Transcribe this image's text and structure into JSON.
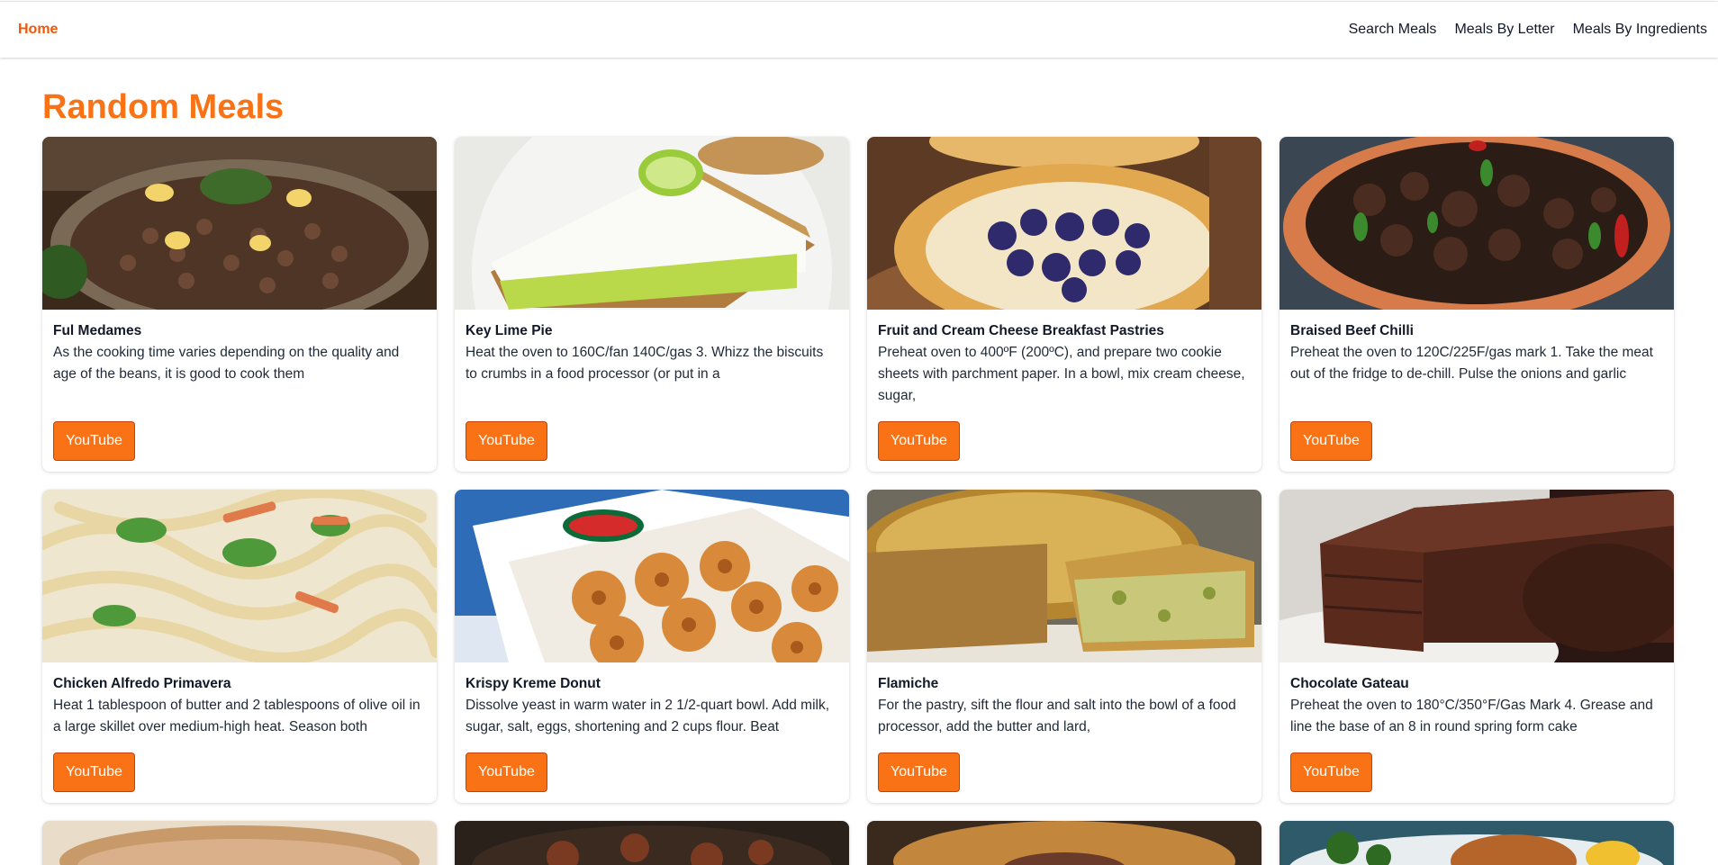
{
  "nav": {
    "home": "Home",
    "links": [
      "Search Meals",
      "Meals By Letter",
      "Meals By Ingredients"
    ]
  },
  "page": {
    "title": "Random Meals"
  },
  "colors": {
    "accent": "#f97316",
    "accent_dark": "#ea580c"
  },
  "meals": [
    {
      "title": "Ful Medames",
      "desc": "As the cooking time varies depending on the quality and age of the beans, it is good to cook them",
      "button": "YouTube",
      "image": "beans-dish-image"
    },
    {
      "title": "Key Lime Pie",
      "desc": "Heat the oven to 160C/fan 140C/gas 3. Whizz the biscuits to crumbs in a food processor (or put in a",
      "button": "YouTube",
      "image": "lime-pie-image"
    },
    {
      "title": "Fruit and Cream Cheese Breakfast Pastries",
      "desc": "Preheat oven to 400ºF (200ºC), and prepare two cookie sheets with parchment paper. In a bowl, mix cream cheese, sugar,",
      "button": "YouTube",
      "image": "blueberry-pastry-image"
    },
    {
      "title": "Braised Beef Chilli",
      "desc": "Preheat the oven to 120C/225F/gas mark 1. Take the meat out of the fridge to de-chill. Pulse the onions and garlic",
      "button": "YouTube",
      "image": "beef-chilli-image"
    },
    {
      "title": "Chicken Alfredo Primavera",
      "desc": "Heat 1 tablespoon of butter and 2 tablespoons of olive oil in a large skillet over medium-high heat. Season both",
      "button": "YouTube",
      "image": "pasta-image"
    },
    {
      "title": "Krispy Kreme Donut",
      "desc": "Dissolve yeast in warm water in 2 1/2-quart bowl. Add milk, sugar, salt, eggs, shortening and 2 cups flour. Beat",
      "button": "YouTube",
      "image": "donuts-image"
    },
    {
      "title": "Flamiche",
      "desc": "For the pastry, sift the flour and salt into the bowl of a food processor, add the butter and lard,",
      "button": "YouTube",
      "image": "quiche-image"
    },
    {
      "title": "Chocolate Gateau",
      "desc": "Preheat the oven to 180°C/350°F/Gas Mark 4. Grease and line the base of an 8 in round spring form cake",
      "button": "YouTube",
      "image": "chocolate-cake-image"
    }
  ]
}
